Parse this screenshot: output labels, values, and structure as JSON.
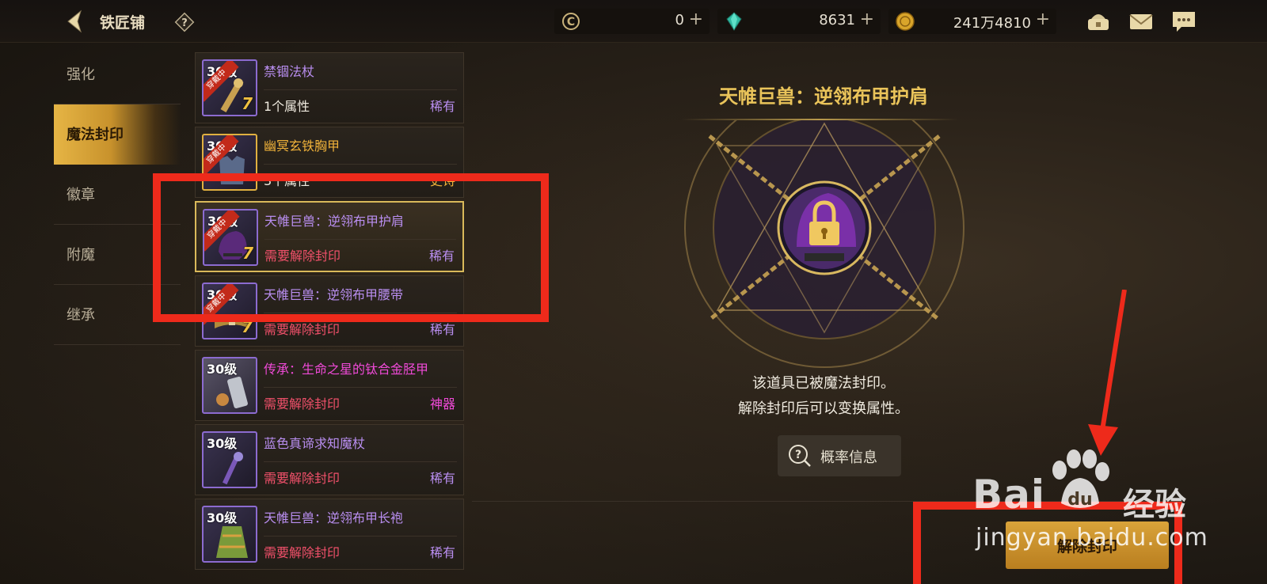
{
  "header": {
    "title": "铁匠铺",
    "help_icon": "question-diamond-icon",
    "back_icon": "back-arrow-icon",
    "resources": [
      {
        "icon": "coin-c-icon",
        "value": "0",
        "plus": "+"
      },
      {
        "icon": "gem-icon",
        "value": "8631",
        "plus": "+"
      },
      {
        "icon": "gold-coin-icon",
        "value": "241万4810",
        "plus": "+"
      }
    ],
    "right_icons": [
      "treasure-icon",
      "mail-icon",
      "chat-icon"
    ]
  },
  "sidebar": {
    "items": [
      {
        "label": "强化",
        "active": false
      },
      {
        "label": "魔法封印",
        "active": true
      },
      {
        "label": "徽章",
        "active": false
      },
      {
        "label": "附魔",
        "active": false
      },
      {
        "label": "继承",
        "active": false
      }
    ]
  },
  "items": [
    {
      "level": "30级",
      "badge": "穿戴中",
      "enhance": "7",
      "name": "禁锢法杖",
      "status": "1个属性",
      "rarity": "稀有"
    },
    {
      "level": "30级",
      "badge": "穿戴中",
      "enhance": "",
      "name": "幽冥玄铁胸甲",
      "status": "3个属性",
      "rarity": "史诗"
    },
    {
      "level": "30级",
      "badge": "穿戴中",
      "enhance": "7",
      "name": "天帷巨兽：逆翎布甲护肩",
      "status": "需要解除封印",
      "rarity": "稀有"
    },
    {
      "level": "30级",
      "badge": "穿戴中",
      "enhance": "7",
      "name": "天帷巨兽：逆翎布甲腰带",
      "status": "需要解除封印",
      "rarity": "稀有"
    },
    {
      "level": "30级",
      "badge": "",
      "enhance": "",
      "name": "传承：生命之星的钛合金胫甲",
      "status": "需要解除封印",
      "rarity": "神器"
    },
    {
      "level": "30级",
      "badge": "",
      "enhance": "",
      "name": "蓝色真谛求知魔杖",
      "status": "需要解除封印",
      "rarity": "稀有"
    },
    {
      "level": "30级",
      "badge": "",
      "enhance": "",
      "name": "天帷巨兽：逆翎布甲长袍",
      "status": "需要解除封印",
      "rarity": "稀有"
    }
  ],
  "detail": {
    "title": "天帷巨兽：逆翎布甲护肩",
    "desc_line1": "该道具已被魔法封印。",
    "desc_line2": "解除封印后可以变换属性。",
    "prob_button": "概率信息",
    "unseal_button": "解除封印"
  },
  "watermark": {
    "logo": "Bai",
    "logo_suffix": "du",
    "cn": "经验",
    "url": "jingyan.baidu.com"
  },
  "colors": {
    "gold": "#eac45a",
    "purple_name": "#b98ef0",
    "epic_name": "#f0b23a",
    "artifact_name": "#f04ad8",
    "status_red": "#f0506a",
    "annotation_red": "#ee2a1b"
  }
}
